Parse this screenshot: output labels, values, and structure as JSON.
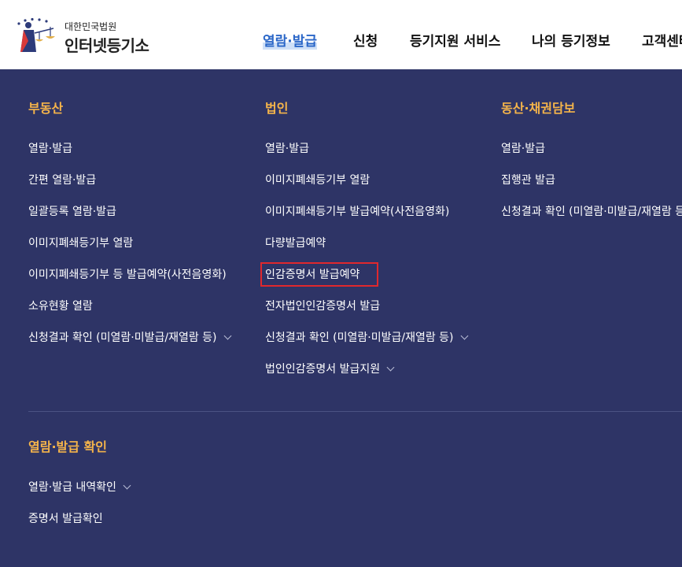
{
  "header": {
    "logo_sub": "대한민국법원",
    "logo_main": "인터넷등기소",
    "nav": [
      "열람·발급",
      "신청",
      "등기지원 서비스",
      "나의 등기정보",
      "고객센터"
    ]
  },
  "menu": {
    "real_estate": {
      "title": "부동산",
      "items": [
        "열람·발급",
        "간편 열람·발급",
        "일괄등록 열람·발급",
        "이미지폐쇄등기부 열람",
        "이미지폐쇄등기부 등 발급예약(사전음영화)",
        "소유현황 열람",
        "신청결과 확인 (미열람·미발급/재열람 등)"
      ]
    },
    "corporation": {
      "title": "법인",
      "items": [
        "열람·발급",
        "이미지폐쇄등기부 열람",
        "이미지폐쇄등기부 발급예약(사전음영화)",
        "다량발급예약",
        "인감증명서 발급예약",
        "전자법인인감증명서 발급",
        "신청결과 확인 (미열람·미발급/재열람 등)",
        "법인인감증명서 발급지원"
      ]
    },
    "movable": {
      "title": "동산·채권담보",
      "items": [
        "열람·발급",
        "집행관 발급",
        "신청결과 확인 (미열람·미발급/재열람 등)"
      ]
    },
    "confirm": {
      "title": "열람·발급 확인",
      "items": [
        "열람·발급 내역확인",
        "증명서 발급확인"
      ]
    }
  },
  "colors": {
    "background": "#2e3466",
    "title": "#f5b44a",
    "active_nav": "#2b67c8",
    "highlight": "#e0282d"
  }
}
